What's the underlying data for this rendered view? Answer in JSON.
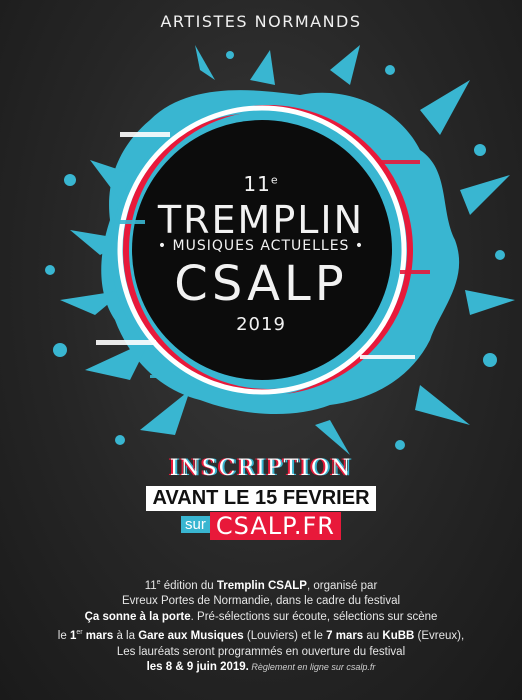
{
  "tagline": "ARTISTES NORMANDS",
  "logo": {
    "edition_num": "11",
    "edition_sup": "e",
    "tremplin": "TREMPLIN",
    "musiques": "• MUSIQUES ACTUELLES •",
    "csalp": "CSALP",
    "year": "2019"
  },
  "cta": {
    "inscription": "INSCRIPTION",
    "deadline": "AVANT LE 15 FEVRIER",
    "sur": "sur",
    "url": "CSALP.FR"
  },
  "description": {
    "l1_sup": "e",
    "l1_a": "11",
    "l1_b": " édition du ",
    "l1_bold": "Tremplin CSALP",
    "l1_c": ", organisé par",
    "l2": "Evreux Portes de Normandie, dans le cadre du festival",
    "l3_bold": "Ça sonne à la porte",
    "l3_b": ". Pré-sélections sur écoute, sélections sur scène",
    "l4_a": "le ",
    "l4_b1": "1",
    "l4_sup": "er",
    "l4_b2": " mars",
    "l4_c": " à la ",
    "l4_b3": "Gare aux Musiques",
    "l4_d": " (Louviers) et le ",
    "l4_b4": "7 mars",
    "l4_e": " au ",
    "l4_b5": "KuBB",
    "l4_f": " (Evreux),",
    "l5": "Les lauréats seront programmés en ouverture du festival",
    "l6_bold": "les  8 & 9 juin 2019.",
    "l6_small": " Règlement en ligne sur csalp.fr"
  },
  "colors": {
    "cyan": "#39b6d1",
    "red": "#e8193a",
    "background": "#262626"
  }
}
